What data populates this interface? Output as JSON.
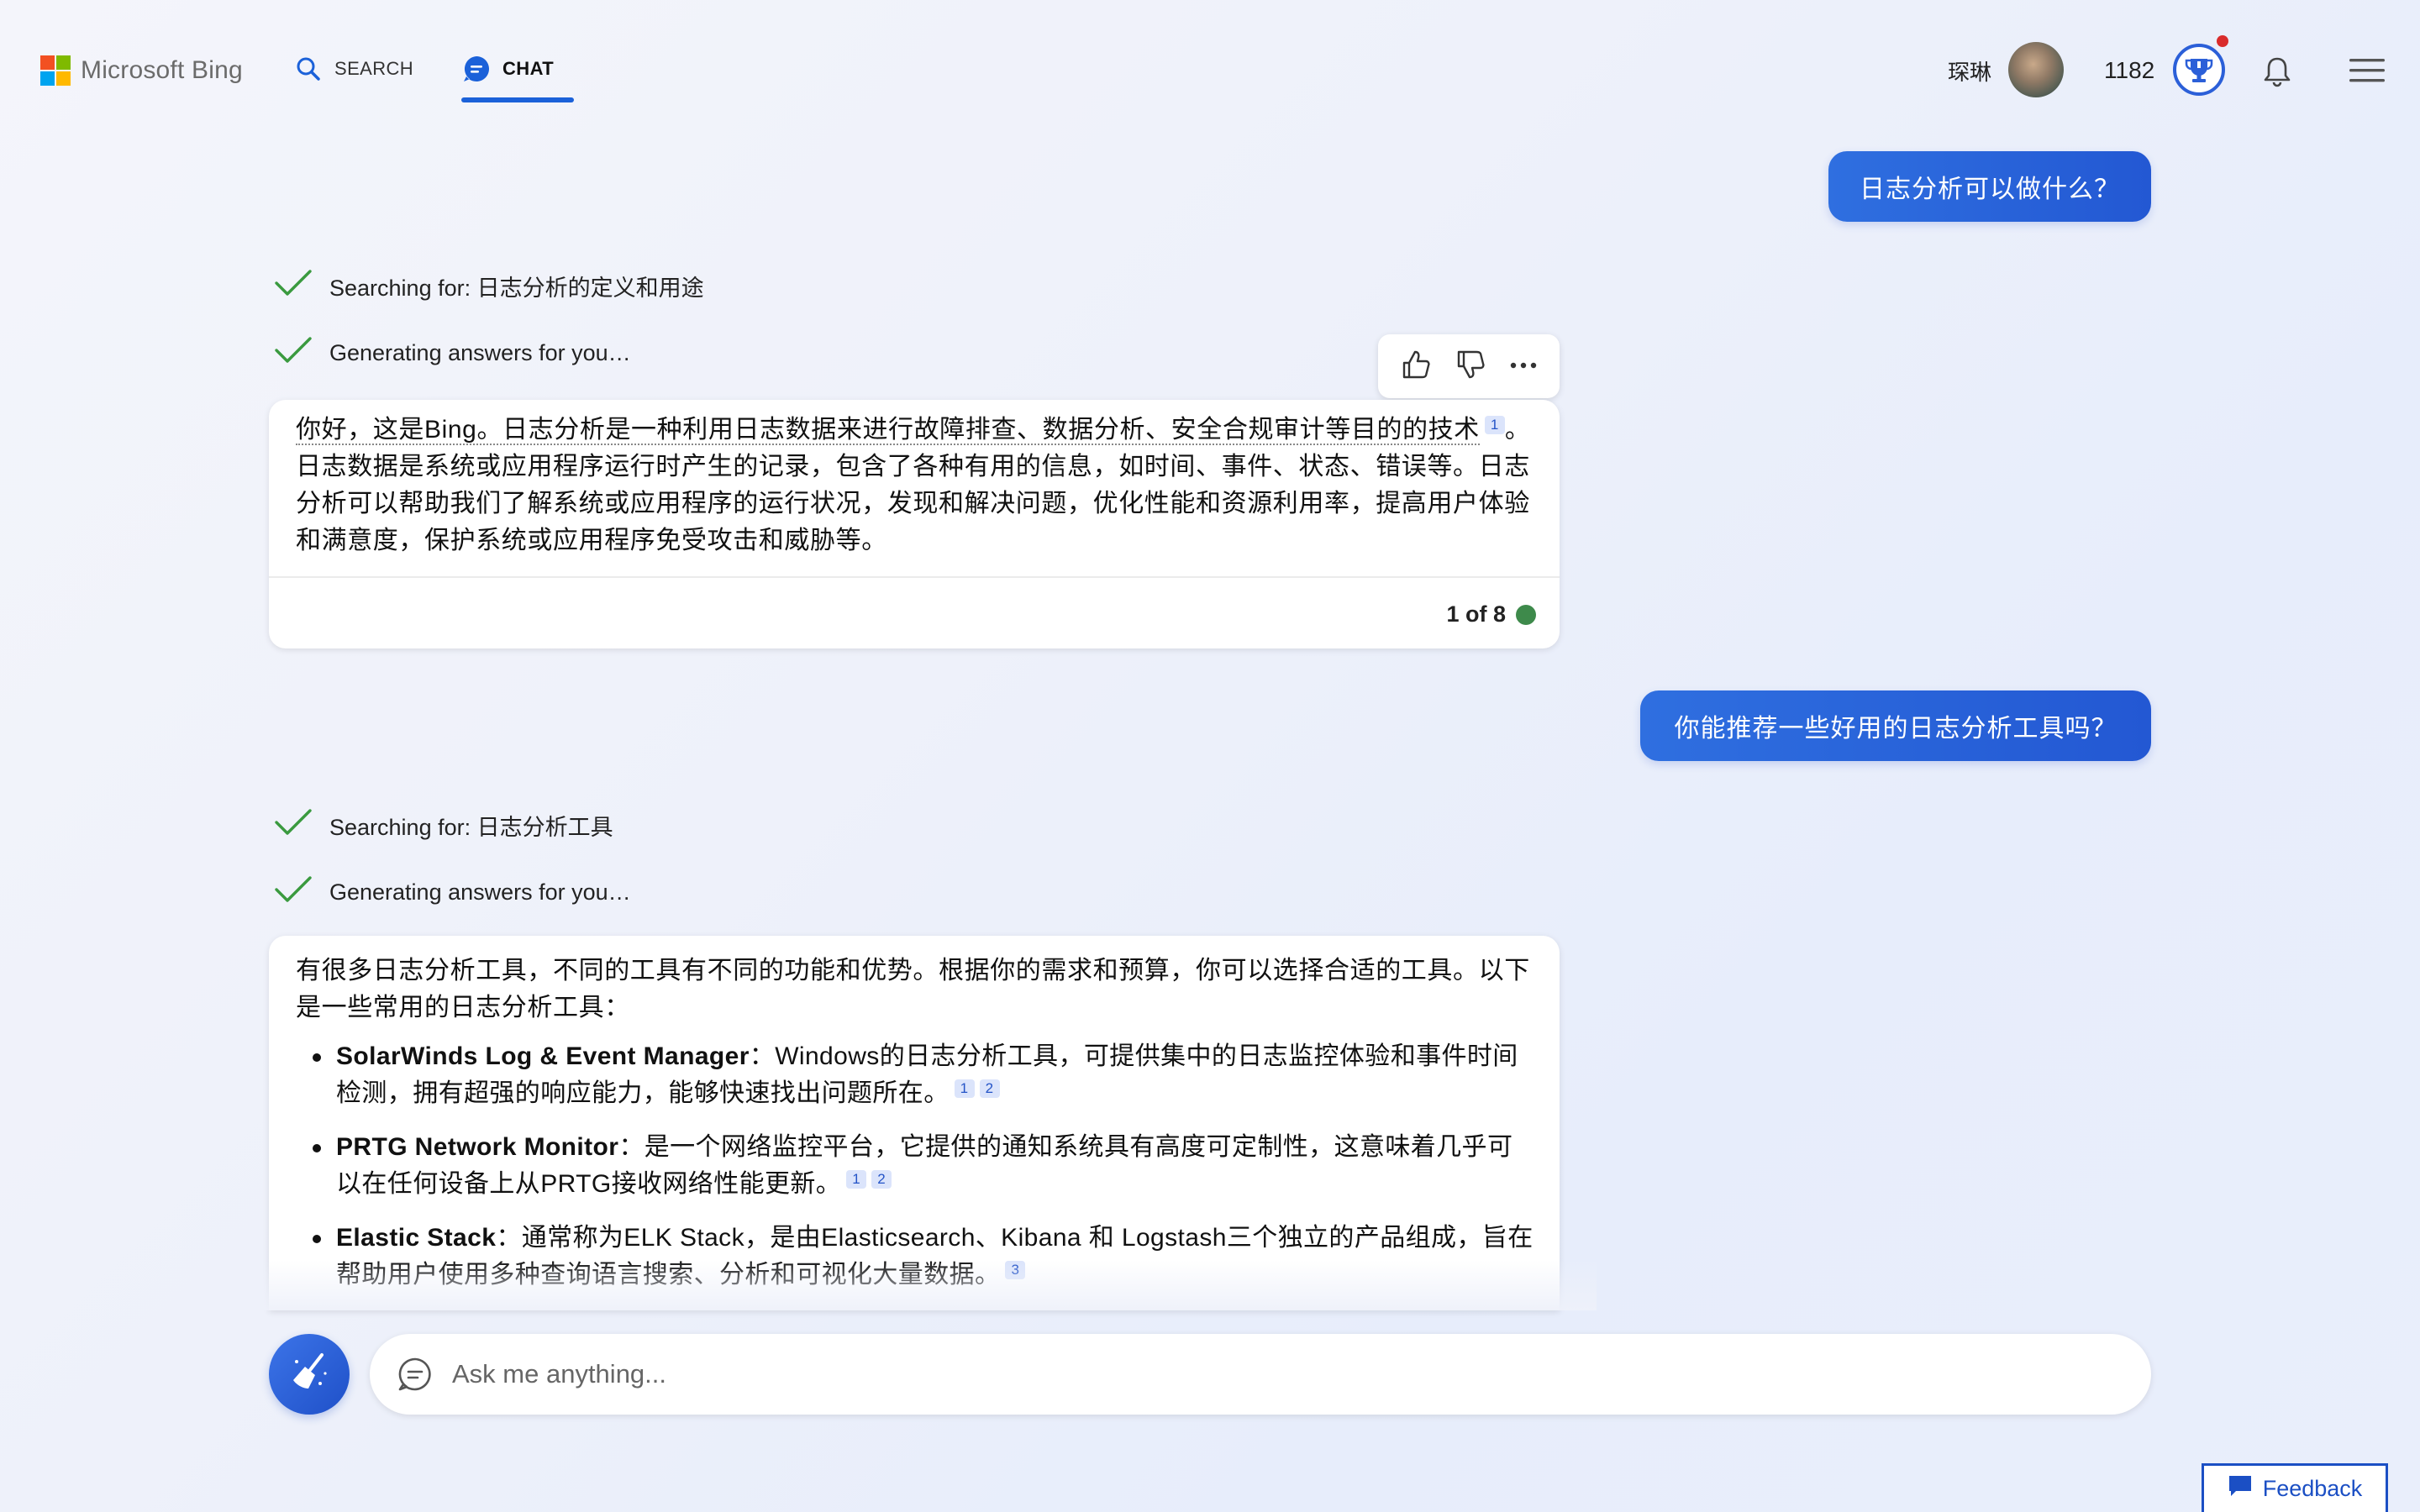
{
  "header": {
    "logo_text": "Microsoft Bing",
    "nav": [
      {
        "label": "SEARCH",
        "icon": "search-icon"
      },
      {
        "label": "CHAT",
        "icon": "chat-icon",
        "active": true
      }
    ],
    "user_name": "琛琳",
    "points": "1182"
  },
  "conversation": {
    "turn1": {
      "question": "日志分析可以做什么？",
      "status_search": "Searching for: 日志分析的定义和用途",
      "status_generate": "Generating answers for you…",
      "answer_part1": "你好，这是Bing。日志分析是一种利用日志数据来进行故障排查、数据分析、安全合规审计等目的的技术",
      "answer_cite": "1",
      "answer_part2": "。日志数据是系统或应用程序运行时产生的记录，包含了各种有用的信息，如时间、事件、状态、错误等。日志分析可以帮助我们了解系统或应用程序的运行状况，发现和解决问题，优化性能和资源利用率，提高用户体验和满意度，保护系统或应用程序免受攻击和威胁等。",
      "turn_count": "1 of 8"
    },
    "turn2": {
      "question": "你能推荐一些好用的日志分析工具吗？",
      "status_search": "Searching for: 日志分析工具",
      "status_generate": "Generating answers for you…",
      "intro": "有很多日志分析工具，不同的工具有不同的功能和优势。根据你的需求和预算，你可以选择合适的工具。以下是一些常用的日志分析工具：",
      "tools": [
        {
          "name": "SolarWinds Log & Event Manager",
          "desc": "：Windows的日志分析工具，可提供集中的日志监控体验和事件时间检测，拥有超强的响应能力，能够快速找出问题所在。",
          "cites": [
            "1",
            "2"
          ]
        },
        {
          "name": "PRTG Network Monitor",
          "desc": "：是一个网络监控平台，它提供的通知系统具有高度可定制性，这意味着几乎可以在任何设备上从PRTG接收网络性能更新。",
          "cites": [
            "1",
            "2"
          ]
        },
        {
          "name": "Elastic Stack",
          "desc": "：通常称为ELK Stack，是由Elasticsearch、Kibana 和 Logstash三个独立的产品组成，旨在帮助用户使用多种查询语言搜索、分析和可视化大量数据。",
          "cites": [
            "3"
          ]
        }
      ]
    }
  },
  "input": {
    "placeholder": "Ask me anything..."
  },
  "feedback": {
    "label": "Feedback"
  },
  "colors": {
    "accent": "#1b61d9",
    "user_bubble": "#2f6fe0",
    "check": "#3a9a3f",
    "status_dot": "#3e8a4b"
  }
}
